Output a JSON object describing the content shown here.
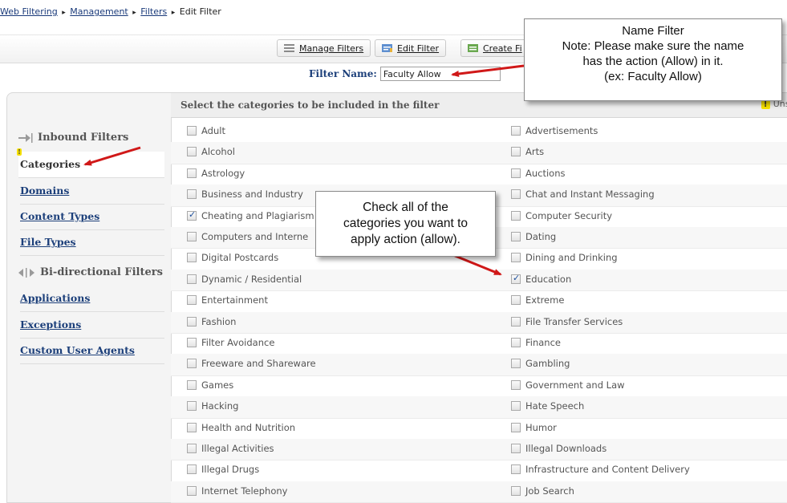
{
  "breadcrumb": {
    "items": [
      "Web Filtering",
      "Management",
      "Filters"
    ],
    "current": "Edit Filter",
    "separator": "▸"
  },
  "toolbar": {
    "manage_filters": "Manage Filters",
    "edit_filter": "Edit Filter",
    "create_filter": "Create Fi"
  },
  "filter_name": {
    "label": "Filter Name:",
    "value": "Faculty Allow"
  },
  "sidebar": {
    "inbound_header": "Inbound Filters",
    "inbound_items": [
      "Categories",
      "Domains",
      "Content Types",
      "File Types"
    ],
    "bidirectional_header": "Bi-directional Filters",
    "bidirectional_items": [
      "Applications",
      "Exceptions",
      "Custom User Agents"
    ],
    "active_item": "Categories"
  },
  "main": {
    "header": "Select the categories to be included in the filter",
    "unsaved": "Unsaved c",
    "categories_left": [
      {
        "label": "Adult",
        "checked": false
      },
      {
        "label": "Alcohol",
        "checked": false
      },
      {
        "label": "Astrology",
        "checked": false
      },
      {
        "label": "Business and Industry",
        "checked": false
      },
      {
        "label": "Cheating and Plagiarism",
        "checked": true
      },
      {
        "label": "Computers and Interne",
        "checked": false
      },
      {
        "label": "Digital Postcards",
        "checked": false
      },
      {
        "label": "Dynamic / Residential",
        "checked": false
      },
      {
        "label": "Entertainment",
        "checked": false
      },
      {
        "label": "Fashion",
        "checked": false
      },
      {
        "label": "Filter Avoidance",
        "checked": false
      },
      {
        "label": "Freeware and Shareware",
        "checked": false
      },
      {
        "label": "Games",
        "checked": false
      },
      {
        "label": "Hacking",
        "checked": false
      },
      {
        "label": "Health and Nutrition",
        "checked": false
      },
      {
        "label": "Illegal Activities",
        "checked": false
      },
      {
        "label": "Illegal Drugs",
        "checked": false
      },
      {
        "label": "Internet Telephony",
        "checked": false
      }
    ],
    "categories_right": [
      {
        "label": "Advertisements",
        "checked": false
      },
      {
        "label": "Arts",
        "checked": false
      },
      {
        "label": "Auctions",
        "checked": false
      },
      {
        "label": "Chat and Instant Messaging",
        "checked": false
      },
      {
        "label": "Computer Security",
        "checked": false
      },
      {
        "label": "Dating",
        "checked": false
      },
      {
        "label": "Dining and Drinking",
        "checked": false
      },
      {
        "label": "Education",
        "checked": true
      },
      {
        "label": "Extreme",
        "checked": false
      },
      {
        "label": "File Transfer Services",
        "checked": false
      },
      {
        "label": "Finance",
        "checked": false
      },
      {
        "label": "Gambling",
        "checked": false
      },
      {
        "label": "Government and Law",
        "checked": false
      },
      {
        "label": "Hate Speech",
        "checked": false
      },
      {
        "label": "Humor",
        "checked": false
      },
      {
        "label": "Illegal Downloads",
        "checked": false
      },
      {
        "label": "Infrastructure and Content Delivery",
        "checked": false
      },
      {
        "label": "Job Search",
        "checked": false
      }
    ]
  },
  "callouts": {
    "name_filter": {
      "lines": [
        "Name Filter",
        "Note: Please make sure the name",
        "has the action (Allow) in it.",
        "(ex: Faculty Allow)"
      ]
    },
    "check_categories": {
      "lines": [
        "Check all of the",
        "categories you want to",
        "apply action (allow)."
      ]
    }
  },
  "colors": {
    "link": "#1c3f7a",
    "arrow": "#d01818",
    "warning": "#f6e000"
  },
  "icons": [
    "list-icon",
    "edit-icon",
    "create-icon",
    "arrow-right-icon",
    "warning-icon",
    "bidirectional-icon"
  ]
}
